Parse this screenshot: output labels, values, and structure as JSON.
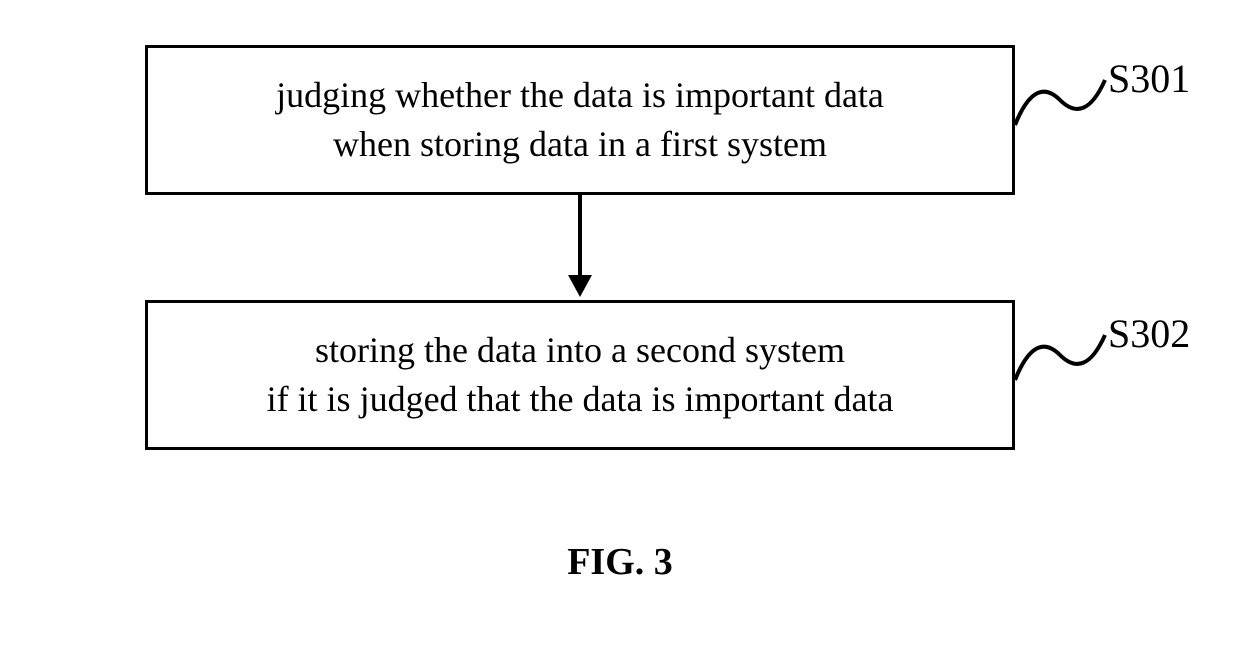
{
  "steps": [
    {
      "id": "S301",
      "line1": "judging whether the data is important data",
      "line2": "when storing data in a first system"
    },
    {
      "id": "S302",
      "line1": "storing the data into a second system",
      "line2": "if it is judged that the data is important data"
    }
  ],
  "figure_caption": "FIG. 3"
}
